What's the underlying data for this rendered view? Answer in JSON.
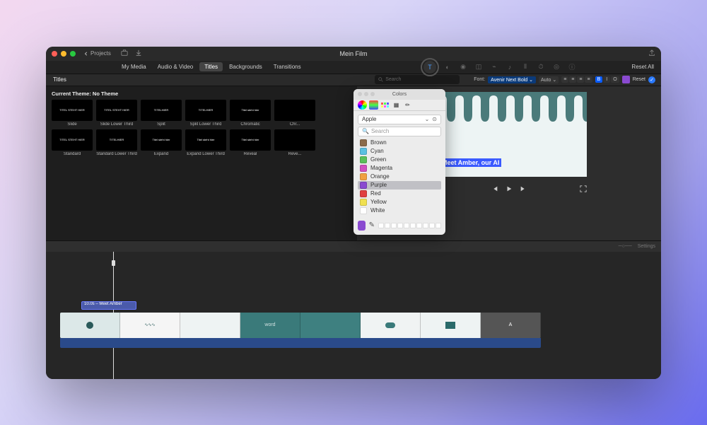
{
  "titlebar": {
    "back_label": "Projects",
    "window_title": "Mein Film"
  },
  "media_tabs": {
    "items": [
      "My Media",
      "Audio & Video",
      "Titles",
      "Backgrounds",
      "Transitions"
    ],
    "active_index": 2,
    "reset_all": "Reset All"
  },
  "browser": {
    "section_label": "Titles",
    "search_placeholder": "Search",
    "theme_label": "Current Theme: No Theme",
    "row1": [
      {
        "label": "Slide",
        "text": "TITEL STEHT HIER"
      },
      {
        "label": "Slide Lower Third",
        "text": "TITEL STEHT HIER"
      },
      {
        "label": "Split",
        "text": "TITELHIER"
      },
      {
        "label": "Split Lower Third",
        "text": "TITELHIER"
      },
      {
        "label": "Chromatic",
        "text": "Titel steht hier"
      },
      {
        "label": "Chr...",
        "text": ""
      }
    ],
    "row2": [
      {
        "label": "Standard",
        "text": "TITEL STEHT HIER"
      },
      {
        "label": "Standard Lower Third",
        "text": "TITELHIER"
      },
      {
        "label": "Expand",
        "text": "Titel steht hier"
      },
      {
        "label": "Expand Lower Third",
        "text": "Titel steht hier"
      },
      {
        "label": "Reveal",
        "text": "Titel steht hier"
      },
      {
        "label": "Reve...",
        "text": ""
      }
    ]
  },
  "inspector": {
    "font_label": "Font:",
    "font_value": "Avenir Next Bold",
    "size_mode": "Auto",
    "style_b": "B",
    "style_i": "I",
    "outline": "O",
    "swatch_color": "#8a4ad0",
    "reset": "Reset"
  },
  "preview": {
    "caption": "Meet Amber, our AI"
  },
  "timeline": {
    "settings_label": "Settings",
    "clip_label": "10.0s – Meet Amber"
  },
  "colors_panel": {
    "title": "Colors",
    "palette_dropdown": "Apple",
    "search_placeholder": "Search",
    "list": [
      {
        "name": "Brown",
        "hex": "#8a6a4a"
      },
      {
        "name": "Cyan",
        "hex": "#5ac0e0"
      },
      {
        "name": "Green",
        "hex": "#5ac05a"
      },
      {
        "name": "Magenta",
        "hex": "#d050c0"
      },
      {
        "name": "Orange",
        "hex": "#f0a040"
      },
      {
        "name": "Purple",
        "hex": "#8a4ad0"
      },
      {
        "name": "Red",
        "hex": "#e04040"
      },
      {
        "name": "Yellow",
        "hex": "#f0e050"
      },
      {
        "name": "White",
        "hex": "#ffffff"
      }
    ],
    "selected_index": 5,
    "current_swatch": "#8a4ad0"
  }
}
